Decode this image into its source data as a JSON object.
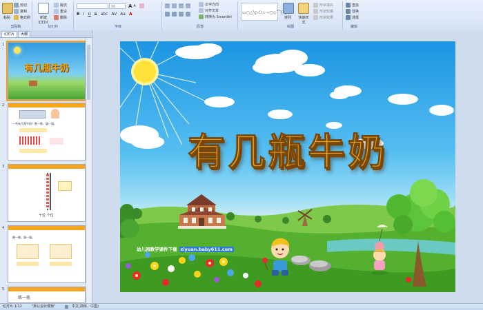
{
  "ribbon": {
    "clipboard": {
      "paste": "粘贴",
      "cut": "剪切",
      "copy": "复制",
      "format": "格式刷",
      "label": "剪贴板"
    },
    "slides": {
      "new_slide": "新建\n幻灯片",
      "layout": "版式",
      "reset": "重设",
      "delete": "删除",
      "label": "幻灯片"
    },
    "font": {
      "size": "96",
      "label": "字体"
    },
    "paragraph": {
      "text_direction": "文字方向",
      "align_text": "对齐文本",
      "smartart": "转换为 SmartArt",
      "label": "段落"
    },
    "drawing": {
      "arrange": "排列",
      "quick_styles": "快速样式",
      "fill": "形状填充",
      "outline": "形状轮廓",
      "effects": "形状效果",
      "label": "绘图"
    },
    "editing": {
      "find": "查找",
      "replace": "替换",
      "select": "选择",
      "label": "编辑"
    }
  },
  "panel": {
    "tabs": [
      "幻灯片",
      "大纲"
    ],
    "thumbnails": [
      {
        "num": "1",
        "title": "有几瓶牛奶"
      },
      {
        "num": "2",
        "text_a": "一共有几瓶牛奶？数一数，填一填。"
      },
      {
        "num": "3",
        "text_a": "十位 个位"
      },
      {
        "num": "4",
        "text_a": "圈一圈，填一填。"
      },
      {
        "num": "5",
        "text_a": "练一练"
      }
    ]
  },
  "slide": {
    "title": "有几瓶牛奶",
    "footnote": "幼儿园教学课件下载",
    "footnote_url": "ziyuan.baby611.com"
  },
  "status": {
    "slide_info": "幻灯片 1/12",
    "theme": "\"默认设计模板\"",
    "language": "中文(简体，中国)"
  }
}
